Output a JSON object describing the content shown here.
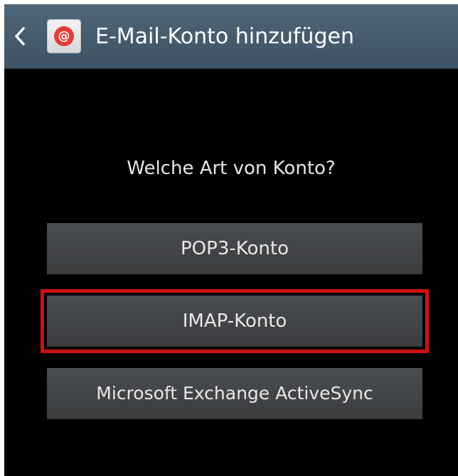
{
  "action_bar": {
    "back_icon": "chevron-left-icon",
    "app_icon": "email-app-icon",
    "app_icon_glyph": "@",
    "title": "E-Mail-Konto hinzufügen"
  },
  "content": {
    "question": "Welche Art von Konto?",
    "options": [
      {
        "label": "POP3-Konto",
        "highlighted": false
      },
      {
        "label": "IMAP-Konto",
        "highlighted": true
      },
      {
        "label": "Microsoft Exchange ActiveSync",
        "highlighted": false
      }
    ]
  },
  "colors": {
    "action_bar": "#475c6e",
    "background": "#000000",
    "button": "#424548",
    "highlight": "#cc1111",
    "icon_accent": "#e13b3b"
  }
}
